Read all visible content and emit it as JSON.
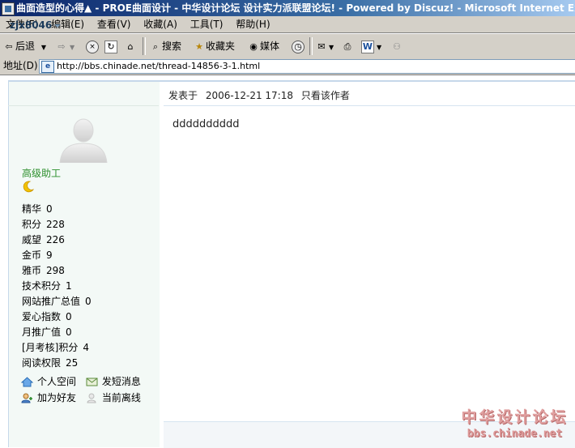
{
  "window": {
    "title": "曲面造型的心得▲ - PROE曲面设计 - 中华设计论坛 设计实力派联盟论坛! - Powered by Discuz! - Microsoft Internet Explorer"
  },
  "menu": [
    "文件(F)",
    "编辑(E)",
    "查看(V)",
    "收藏(A)",
    "工具(T)",
    "帮助(H)"
  ],
  "toolbar": {
    "back": "后退",
    "search": "搜索",
    "favorites": "收藏夹",
    "media": "媒体"
  },
  "address": {
    "label": "地址(D)",
    "url": "http://bbs.chinade.net/thread-14856-3-1.html"
  },
  "author": {
    "username": "zjx8046",
    "rank": "高级助工",
    "stats": [
      {
        "label": "精华",
        "value": "0"
      },
      {
        "label": "积分",
        "value": "228"
      },
      {
        "label": "威望",
        "value": "226"
      },
      {
        "label": "金币",
        "value": "9"
      },
      {
        "label": "雅币",
        "value": "298"
      },
      {
        "label": "技术积分",
        "value": "1"
      },
      {
        "label": "网站推广总值",
        "value": "0"
      },
      {
        "label": "爱心指数",
        "value": "0"
      },
      {
        "label": "月推广值",
        "value": "0"
      },
      {
        "label": "[月考核]积分",
        "value": "4"
      },
      {
        "label": "阅读权限",
        "value": "25"
      }
    ],
    "links": {
      "space": "个人空间",
      "message": "发短消息",
      "add_friend": "加为好友",
      "status": "当前离线"
    }
  },
  "post": {
    "posted_label": "发表于",
    "date": "2006-12-21 17:18",
    "only_author": "只看该作者",
    "body": "dddddddddd"
  },
  "watermark": {
    "line1": "中华设计论坛",
    "line2": "bbs.chinade.net"
  }
}
